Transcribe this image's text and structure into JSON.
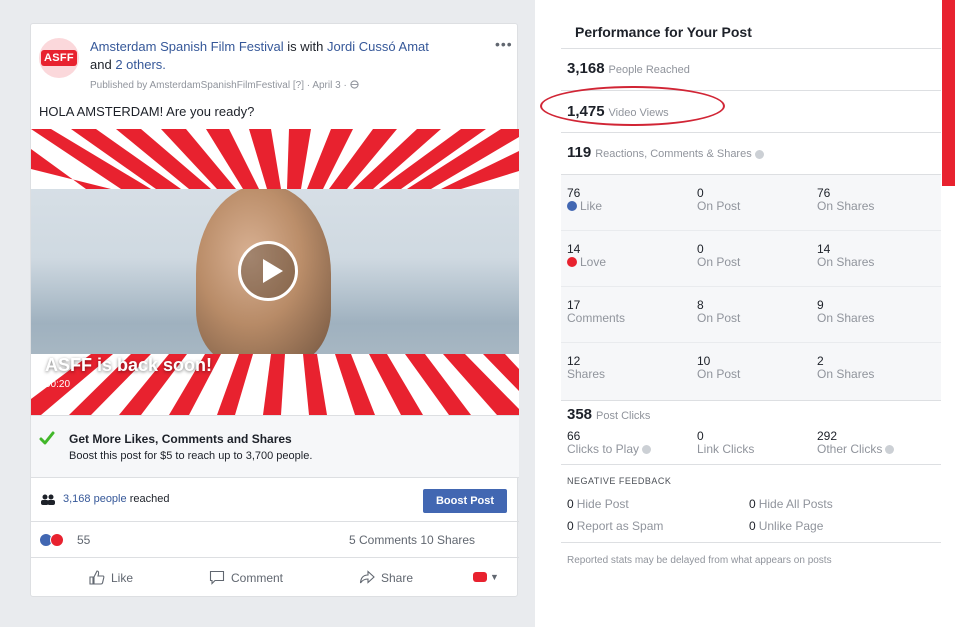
{
  "post": {
    "page_name": "Amsterdam Spanish Film Festival",
    "with_text": "is with",
    "tagged_person": "Jordi Cussó Amat",
    "and_text": "and",
    "others": "2 others.",
    "avatar_text": "ASFF",
    "published_by": "Published by AmsterdamSpanishFilmFestival [?] · April 3 ·",
    "text": "HOLA AMSTERDAM! Are you ready?",
    "video_title": "ASFF is back soon!",
    "video_time": "00:20",
    "boost_title": "Get More Likes, Comments and Shares",
    "boost_desc": "Boost this post for $5 to reach up to 3,700 people.",
    "reached_count": "3,168 people",
    "reached_label": "reached",
    "boost_button": "Boost Post",
    "reaction_count": "55",
    "comments_shares": "5 Comments  10 Shares",
    "actions": {
      "like": "Like",
      "comment": "Comment",
      "share": "Share"
    }
  },
  "insights": {
    "title": "Performance for Your Post",
    "people_reached": {
      "value": "3,168",
      "label": "People Reached"
    },
    "video_views": {
      "value": "1,475",
      "label": "Video Views"
    },
    "engagement": {
      "value": "119",
      "label": "Reactions, Comments & Shares"
    },
    "breakdown": [
      {
        "value": "76",
        "label": "Like",
        "post": "0",
        "post_label": "On Post",
        "shares": "76",
        "shares_label": "On Shares"
      },
      {
        "value": "14",
        "label": "Love",
        "post": "0",
        "post_label": "On Post",
        "shares": "14",
        "shares_label": "On Shares"
      },
      {
        "value": "17",
        "label": "Comments",
        "post": "8",
        "post_label": "On Post",
        "shares": "9",
        "shares_label": "On Shares"
      },
      {
        "value": "12",
        "label": "Shares",
        "post": "10",
        "post_label": "On Post",
        "shares": "2",
        "shares_label": "On Shares"
      }
    ],
    "post_clicks": {
      "value": "358",
      "label": "Post Clicks"
    },
    "clicks": [
      {
        "value": "66",
        "label": "Clicks to Play"
      },
      {
        "value": "0",
        "label": "Link Clicks"
      },
      {
        "value": "292",
        "label": "Other Clicks"
      }
    ],
    "negative_title": "NEGATIVE FEEDBACK",
    "negative": [
      {
        "value": "0",
        "label": "Hide Post"
      },
      {
        "value": "0",
        "label": "Hide All Posts"
      },
      {
        "value": "0",
        "label": "Report as Spam"
      },
      {
        "value": "0",
        "label": "Unlike Page"
      }
    ],
    "footnote": "Reported stats may be delayed from what appears on posts"
  },
  "colors": {
    "brand_red": "#e8222f",
    "fb_blue": "#4267b2",
    "link_blue": "#365899",
    "highlight_oval": "#d12535"
  }
}
